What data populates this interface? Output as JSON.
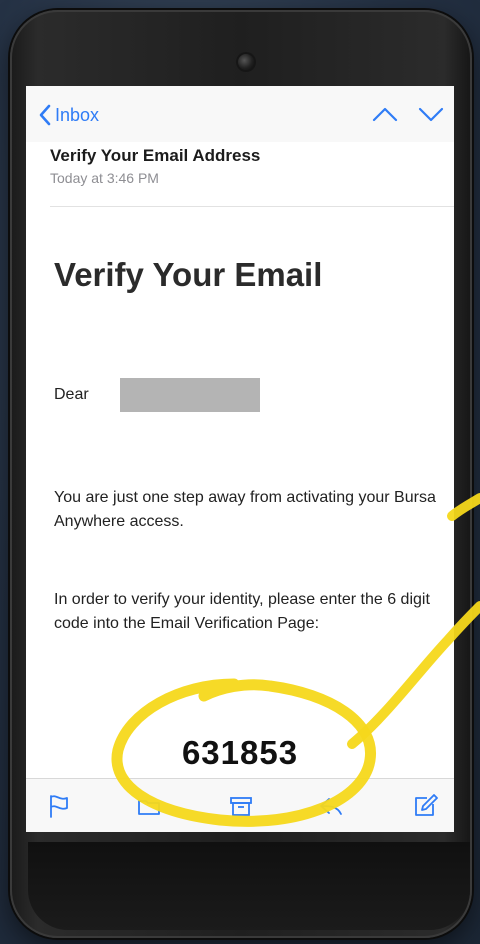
{
  "nav": {
    "back_label": "Inbox"
  },
  "message": {
    "subject": "Verify Your Email Address",
    "time": "Today at 3:46 PM",
    "heading": "Verify Your Email",
    "greeting": "Dear",
    "para1": "You are just one step away from activating your Bursa Anywhere access.",
    "para2": "In order to verify your identity, please enter the 6 digit code into the Email Verification Page:",
    "code": "631853"
  },
  "toolbar": {
    "icons": [
      "flag-icon",
      "folder-icon",
      "archive-icon",
      "reply-icon",
      "compose-icon"
    ]
  },
  "colors": {
    "accent": "#2f7cf6",
    "highlight": "#f5d81b"
  }
}
